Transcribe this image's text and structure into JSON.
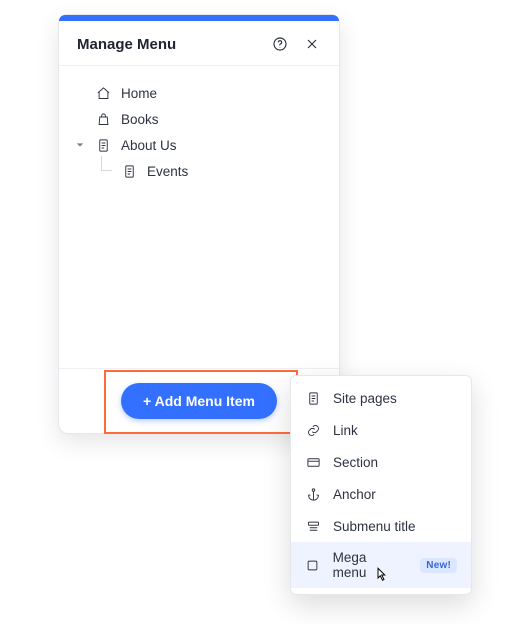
{
  "panel": {
    "title": "Manage Menu",
    "help_icon": "help-icon",
    "close_icon": "close-icon"
  },
  "tree": {
    "items": [
      {
        "label": "Home",
        "icon": "home-icon",
        "level": 0,
        "expandable": false
      },
      {
        "label": "Books",
        "icon": "bag-icon",
        "level": 0,
        "expandable": false
      },
      {
        "label": "About Us",
        "icon": "page-icon",
        "level": 0,
        "expandable": true,
        "expanded": true
      },
      {
        "label": "Events",
        "icon": "page-icon",
        "level": 1,
        "expandable": false
      }
    ]
  },
  "footer": {
    "add_button_label": "+ Add Menu Item"
  },
  "dropdown": {
    "items": [
      {
        "label": "Site pages",
        "icon": "page-icon"
      },
      {
        "label": "Link",
        "icon": "link-icon"
      },
      {
        "label": "Section",
        "icon": "section-icon"
      },
      {
        "label": "Anchor",
        "icon": "anchor-icon"
      },
      {
        "label": "Submenu title",
        "icon": "submenu-icon"
      },
      {
        "label": "Mega menu",
        "icon": "square-icon",
        "badge": "New!",
        "hover": true
      }
    ]
  }
}
